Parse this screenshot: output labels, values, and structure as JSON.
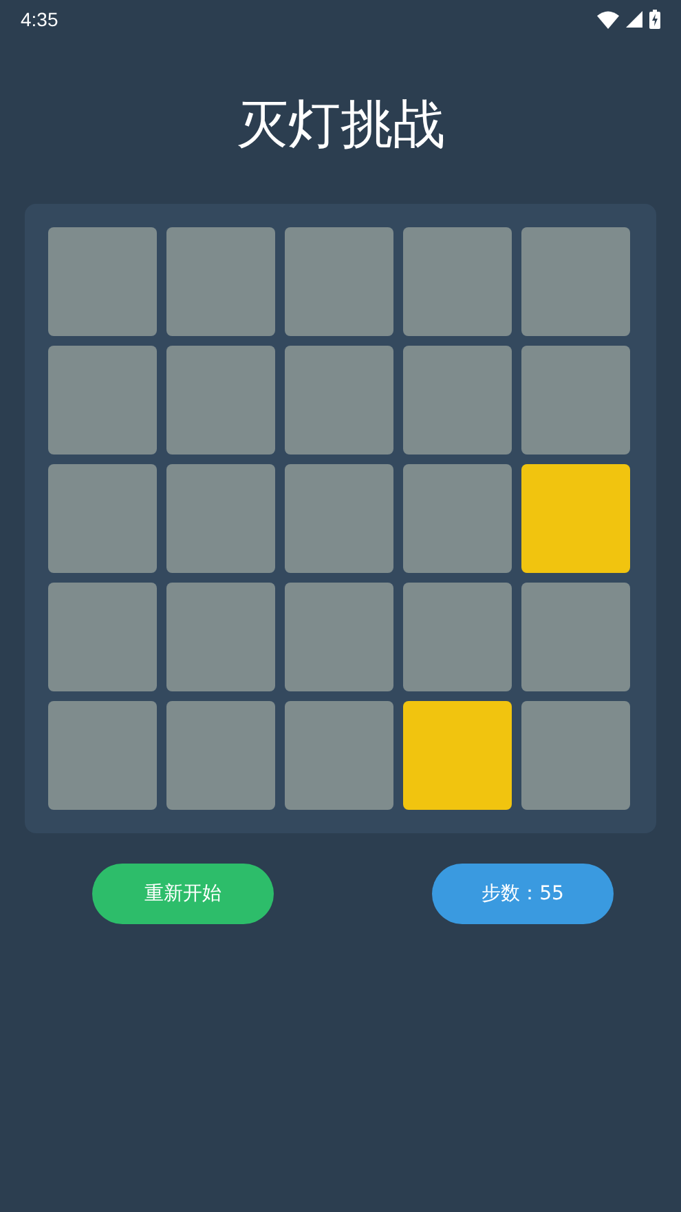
{
  "status_bar": {
    "time": "4:35"
  },
  "title": "灭灯挑战",
  "board": {
    "rows": [
      {
        "cells": [
          {
            "on": false
          },
          {
            "on": false
          },
          {
            "on": false
          },
          {
            "on": false
          },
          {
            "on": false
          }
        ]
      },
      {
        "cells": [
          {
            "on": false
          },
          {
            "on": false
          },
          {
            "on": false
          },
          {
            "on": false
          },
          {
            "on": false
          }
        ]
      },
      {
        "cells": [
          {
            "on": false
          },
          {
            "on": false
          },
          {
            "on": false
          },
          {
            "on": false
          },
          {
            "on": true
          }
        ]
      },
      {
        "cells": [
          {
            "on": false
          },
          {
            "on": false
          },
          {
            "on": false
          },
          {
            "on": false
          },
          {
            "on": false
          }
        ]
      },
      {
        "cells": [
          {
            "on": false
          },
          {
            "on": false
          },
          {
            "on": false
          },
          {
            "on": true
          },
          {
            "on": false
          }
        ]
      }
    ]
  },
  "restart_button": "重新开始",
  "steps": "步数：55"
}
